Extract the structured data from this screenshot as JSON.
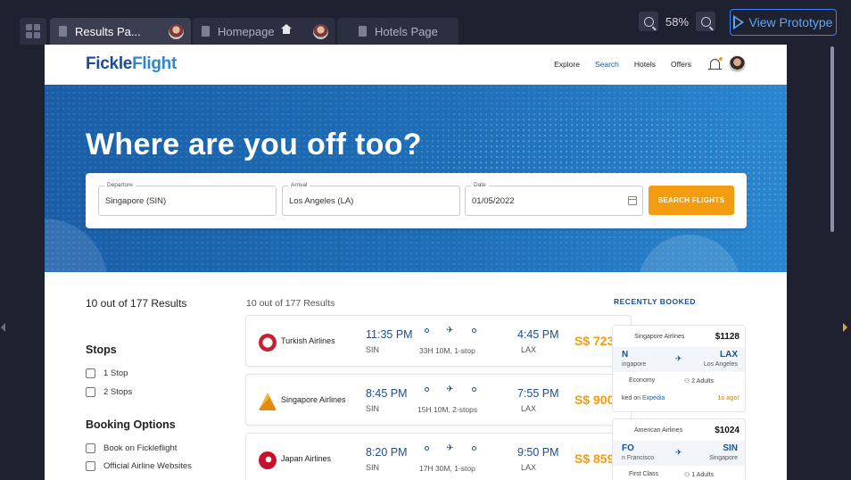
{
  "tabs": [
    {
      "label": "Results Pa...",
      "active": true
    },
    {
      "label": "Homepage",
      "active": false
    },
    {
      "label": "Hotels Page",
      "active": false
    }
  ],
  "zoom": {
    "level": "58%"
  },
  "toolbar": {
    "view_prototype": "View Prototype"
  },
  "nav": {
    "logo_a": "Fickle",
    "logo_b": "Flight",
    "links": [
      "Explore",
      "Search",
      "Hotels",
      "Offers"
    ]
  },
  "hero": {
    "title": "Where are you off too?"
  },
  "search": {
    "departure_label": "Departure",
    "departure_value": "Singapore (SIN)",
    "arrival_label": "Arrival",
    "arrival_value": "Los Angeles (LA)",
    "date_label": "Date",
    "date_value": "01/05/2022",
    "button": "SEARCH FLIGHTS"
  },
  "filters": {
    "results_count": "10 out of 177 Results",
    "stops_title": "Stops",
    "stops": [
      "1 Stop",
      "2 Stops"
    ],
    "booking_title": "Booking Options",
    "booking": [
      "Book on Fickleflight",
      "Official Airline Websites"
    ]
  },
  "results": {
    "header": "10 out of 177 Results",
    "flights": [
      {
        "airline": "Turkish Airlines",
        "dep_time": "11:35 PM",
        "from": "SIN",
        "arr_time": "4:45 PM",
        "to": "LAX",
        "duration": "33H 10M, 1-stop",
        "price": "S$ 723"
      },
      {
        "airline": "Singapore Airlines",
        "dep_time": "8:45 PM",
        "from": "SIN",
        "arr_time": "7:55 PM",
        "to": "LAX",
        "duration": "15H 10M, 2-stops",
        "price": "S$ 900"
      },
      {
        "airline": "Japan Airlines",
        "dep_time": "8:20 PM",
        "from": "SIN",
        "arr_time": "9:50 PM",
        "to": "LAX",
        "duration": "17H 30M, 1-stop",
        "price": "S$ 859"
      }
    ]
  },
  "recent": {
    "title": "RECENTLY BOOKED",
    "items": [
      {
        "airline": "Singapore Airlines",
        "price": "$1128",
        "from_code": "N",
        "from_city": "ingapore",
        "to_code": "LAX",
        "to_city": "Los Angeles",
        "class": "Economy",
        "pax": "2 Adults",
        "booked": "ked on",
        "via": "Expedia",
        "ago": "1s ago!"
      },
      {
        "airline": "American Airlines",
        "price": "$1024",
        "from_code": "FO",
        "from_city": "n Francisco",
        "to_code": "SIN",
        "to_city": "Singapore",
        "class": "First Class",
        "pax": "1 Adults"
      }
    ]
  },
  "colors": {
    "brand": "#1d4d8f",
    "accent": "#f39c12",
    "hero": "#1e6fb8",
    "prototype_button": "#3b82f6"
  }
}
